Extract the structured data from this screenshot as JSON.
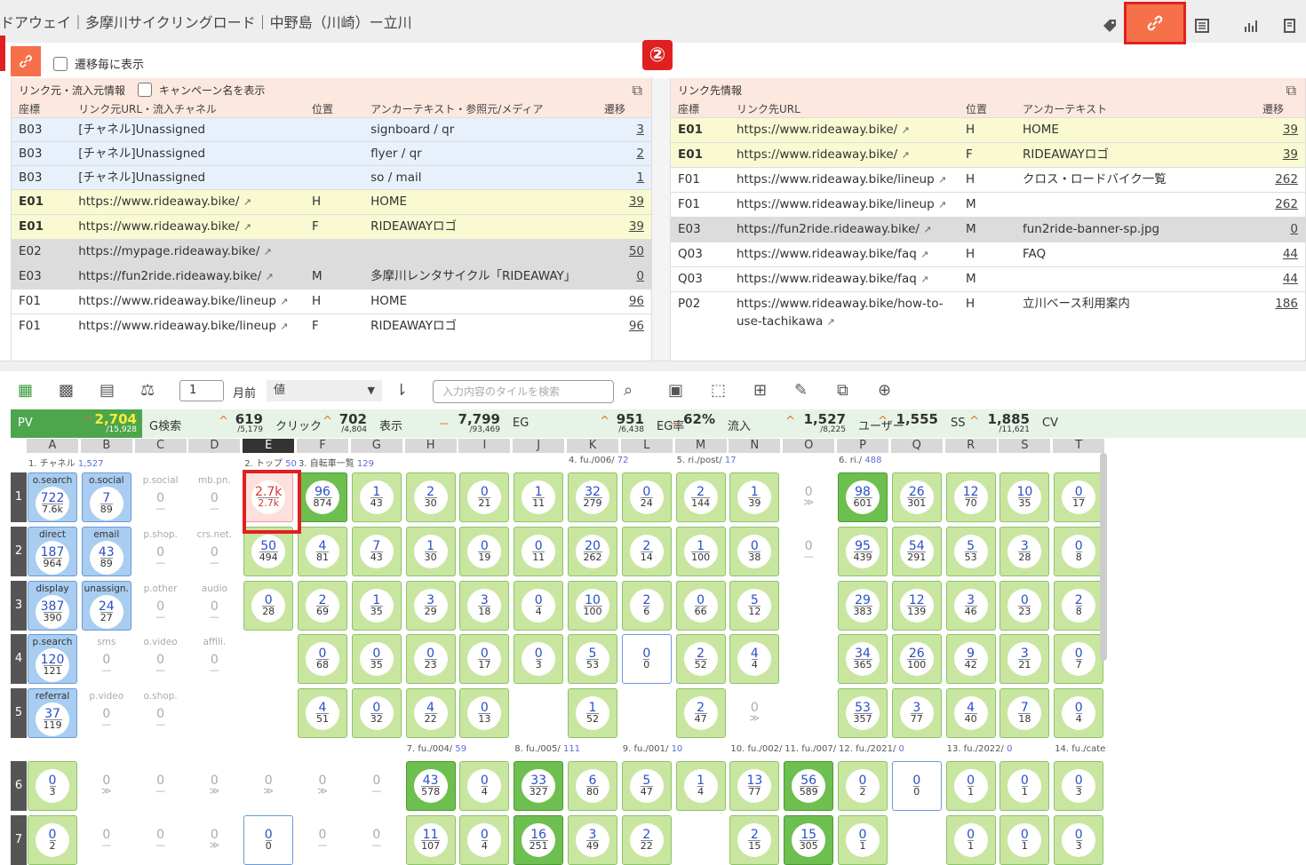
{
  "title": "ドアウェイ｜多摩川サイクリングロード｜中野島（川崎）ー立川",
  "badge": "②",
  "transition_label": "遷移毎に表示",
  "left_panel": {
    "header": "リンク元・流入元情報",
    "campaign_label": "キャンペーン名を表示",
    "cols": [
      "座標",
      "リンク元URL・流入チャネル",
      "位置",
      "アンカーテキスト・参照元/メディア",
      "遷移"
    ],
    "rows": [
      {
        "c": "B03",
        "u": "[チャネル]Unassigned",
        "p": "",
        "a": "signboard / qr",
        "n": "3",
        "k": "b"
      },
      {
        "c": "B03",
        "u": "[チャネル]Unassigned",
        "p": "",
        "a": "flyer / qr",
        "n": "2",
        "k": "b"
      },
      {
        "c": "B03",
        "u": "[チャネル]Unassigned",
        "p": "",
        "a": "so / mail",
        "n": "1",
        "k": "b"
      },
      {
        "c": "E01",
        "u": "https://www.rideaway.bike/",
        "p": "H",
        "a": "HOME",
        "n": "39",
        "k": "y"
      },
      {
        "c": "E01",
        "u": "https://www.rideaway.bike/",
        "p": "F",
        "a": "RIDEAWAYロゴ",
        "n": "39",
        "k": "y"
      },
      {
        "c": "E02",
        "u": "https://mypage.rideaway.bike/",
        "p": "",
        "a": "",
        "n": "50",
        "k": "g"
      },
      {
        "c": "E03",
        "u": "https://fun2ride.rideaway.bike/",
        "p": "M",
        "a": "多摩川レンタサイクル「RIDEAWAY」",
        "n": "0",
        "k": "g"
      },
      {
        "c": "F01",
        "u": "https://www.rideaway.bike/lineup",
        "p": "H",
        "a": "HOME",
        "n": "96",
        "k": "w"
      },
      {
        "c": "F01",
        "u": "https://www.rideaway.bike/lineup",
        "p": "F",
        "a": "RIDEAWAYロゴ",
        "n": "96",
        "k": "w"
      }
    ]
  },
  "right_panel": {
    "header": "リンク先情報",
    "cols": [
      "座標",
      "リンク先URL",
      "位置",
      "アンカーテキスト",
      "遷移"
    ],
    "rows": [
      {
        "c": "E01",
        "u": "https://www.rideaway.bike/",
        "p": "H",
        "a": "HOME",
        "n": "39",
        "k": "y"
      },
      {
        "c": "E01",
        "u": "https://www.rideaway.bike/",
        "p": "F",
        "a": "RIDEAWAYロゴ",
        "n": "39",
        "k": "y"
      },
      {
        "c": "F01",
        "u": "https://www.rideaway.bike/lineup",
        "p": "H",
        "a": "クロス・ロードバイク一覧",
        "n": "262",
        "k": "w"
      },
      {
        "c": "F01",
        "u": "https://www.rideaway.bike/lineup",
        "p": "M",
        "a": "",
        "n": "262",
        "k": "w"
      },
      {
        "c": "E03",
        "u": "https://fun2ride.rideaway.bike/",
        "p": "M",
        "a": "fun2ride-banner-sp.jpg",
        "n": "0",
        "k": "g"
      },
      {
        "c": "Q03",
        "u": "https://www.rideaway.bike/faq",
        "p": "H",
        "a": "FAQ",
        "n": "44",
        "k": "w"
      },
      {
        "c": "Q03",
        "u": "https://www.rideaway.bike/faq",
        "p": "M",
        "a": "",
        "n": "44",
        "k": "w"
      },
      {
        "c": "P02",
        "u": "https://www.rideaway.bike/how-to-use-tachikawa",
        "p": "H",
        "a": "立川ベース利用案内",
        "n": "186",
        "k": "w"
      }
    ]
  },
  "toolbar": {
    "months": "1",
    "month_unit": "月前",
    "value_select": "値",
    "search_placeholder": "入力内容のタイルを検索"
  },
  "metrics": [
    {
      "label": "PV",
      "trend": "^",
      "val": "2,704",
      "sub": "/15,928"
    },
    {
      "label": "G検索",
      "trend": "^",
      "val": "619",
      "sub": "/5,179"
    },
    {
      "label": "クリック",
      "trend": "^",
      "val": "702",
      "sub": "/4,804"
    },
    {
      "label": "表示",
      "trend": "－",
      "val": "7,799",
      "sub": "/93,469"
    },
    {
      "label": "EG",
      "trend": "^",
      "val": "951",
      "sub": "/6,438"
    },
    {
      "label": "EG率",
      "trend": "－",
      "val": "62%",
      "sub": ""
    },
    {
      "label": "流入",
      "trend": "^",
      "val": "1,527",
      "sub": "/8,225"
    },
    {
      "label": "ユーザー",
      "trend": "^",
      "val": "1,555",
      "sub": ""
    },
    {
      "label": "SS",
      "trend": "^",
      "val": "1,885",
      "sub": "/11,621"
    },
    {
      "label": "CV",
      "trend": "",
      "val": "",
      "sub": ""
    }
  ],
  "columns": [
    "A",
    "B",
    "C",
    "D",
    "E",
    "F",
    "G",
    "H",
    "I",
    "J",
    "K",
    "L",
    "M",
    "N",
    "O",
    "P",
    "Q",
    "R",
    "S",
    "T"
  ],
  "page_labels_top": [
    {
      "col": 0,
      "t": "1. チャネル",
      "n": "1,527"
    },
    {
      "col": 4,
      "t": "2. トップ",
      "n": "50"
    },
    {
      "col": 5,
      "t": "3. 自転車一覧",
      "n": "129"
    },
    {
      "col": 10,
      "t": "4. fu./006/",
      "n": "72"
    },
    {
      "col": 12,
      "t": "5. ri./post/",
      "n": "17"
    },
    {
      "col": 15,
      "t": "6. ri./",
      "n": "488"
    }
  ],
  "page_labels_mid": [
    {
      "col": 7,
      "t": "7. fu./004/",
      "n": "59"
    },
    {
      "col": 9,
      "t": "8. fu./005/",
      "n": "111"
    },
    {
      "col": 11,
      "t": "9. fu./001/",
      "n": "10"
    },
    {
      "col": 13,
      "t": "10. fu./002/",
      "n": ""
    },
    {
      "col": 14,
      "t": "11. fu./007/",
      "n": ""
    },
    {
      "col": 15,
      "t": "12. fu./2021/",
      "n": "0"
    },
    {
      "col": 17,
      "t": "13. fu./2022/",
      "n": "0"
    },
    {
      "col": 19,
      "t": "14. fu./cate",
      "n": ""
    }
  ],
  "rows": [
    "1",
    "2",
    "3",
    "4",
    "5",
    "6",
    "7"
  ],
  "grid": [
    [
      {
        "s": "cb2",
        "t": "o.search",
        "a": "722",
        "b": "7.6k"
      },
      {
        "s": "cb2",
        "t": "o.social",
        "a": "7",
        "b": "89"
      },
      {
        "s": "cempty",
        "t": "p.social",
        "a": "0",
        "b": "—"
      },
      {
        "s": "cempty",
        "t": "mb.pn.",
        "a": "0",
        "b": "—"
      },
      {
        "s": "sel",
        "t": "",
        "a": "2.7k",
        "b": "2.7k"
      },
      {
        "s": "cgd",
        "t": "",
        "a": "96",
        "b": "874"
      },
      {
        "s": "cg",
        "t": "",
        "a": "1",
        "b": "43"
      },
      {
        "s": "cg",
        "t": "",
        "a": "2",
        "b": "30"
      },
      {
        "s": "cg",
        "t": "",
        "a": "0",
        "b": "21"
      },
      {
        "s": "cg",
        "t": "",
        "a": "1",
        "b": "11"
      },
      {
        "s": "cg",
        "t": "",
        "a": "32",
        "b": "279"
      },
      {
        "s": "cg",
        "t": "",
        "a": "0",
        "b": "24"
      },
      {
        "s": "cg",
        "t": "",
        "a": "2",
        "b": "144"
      },
      {
        "s": "cg",
        "t": "",
        "a": "1",
        "b": "39"
      },
      {
        "s": "cempty",
        "t": "",
        "a": "0",
        "b": "≫"
      },
      {
        "s": "cgd",
        "t": "",
        "a": "98",
        "b": "601"
      },
      {
        "s": "cg",
        "t": "",
        "a": "26",
        "b": "301"
      },
      {
        "s": "cg",
        "t": "",
        "a": "12",
        "b": "70"
      },
      {
        "s": "cg",
        "t": "",
        "a": "10",
        "b": "35"
      },
      {
        "s": "cg",
        "t": "",
        "a": "0",
        "b": "17"
      }
    ],
    [
      {
        "s": "cb2",
        "t": "direct",
        "a": "187",
        "b": "964"
      },
      {
        "s": "cb2",
        "t": "email",
        "a": "43",
        "b": "89"
      },
      {
        "s": "cempty",
        "t": "p.shop.",
        "a": "0",
        "b": "—"
      },
      {
        "s": "cempty",
        "t": "crs.net.",
        "a": "0",
        "b": "—"
      },
      {
        "s": "cg",
        "t": "",
        "a": "50",
        "b": "494"
      },
      {
        "s": "cg",
        "t": "",
        "a": "4",
        "b": "81"
      },
      {
        "s": "cg",
        "t": "",
        "a": "7",
        "b": "43"
      },
      {
        "s": "cg",
        "t": "",
        "a": "1",
        "b": "30"
      },
      {
        "s": "cg",
        "t": "",
        "a": "0",
        "b": "19"
      },
      {
        "s": "cg",
        "t": "",
        "a": "0",
        "b": "11"
      },
      {
        "s": "cg",
        "t": "",
        "a": "20",
        "b": "262"
      },
      {
        "s": "cg",
        "t": "",
        "a": "2",
        "b": "14"
      },
      {
        "s": "cg",
        "t": "",
        "a": "1",
        "b": "100"
      },
      {
        "s": "cg",
        "t": "",
        "a": "0",
        "b": "38"
      },
      {
        "s": "cempty",
        "t": "",
        "a": "0",
        "b": "—"
      },
      {
        "s": "cg",
        "t": "",
        "a": "95",
        "b": "439"
      },
      {
        "s": "cg",
        "t": "",
        "a": "54",
        "b": "291"
      },
      {
        "s": "cg",
        "t": "",
        "a": "5",
        "b": "53"
      },
      {
        "s": "cg",
        "t": "",
        "a": "3",
        "b": "28"
      },
      {
        "s": "cg",
        "t": "",
        "a": "0",
        "b": "8"
      }
    ],
    [
      {
        "s": "cb2",
        "t": "display",
        "a": "387",
        "b": "390"
      },
      {
        "s": "cb2",
        "t": "unassign.",
        "a": "24",
        "b": "27"
      },
      {
        "s": "cempty",
        "t": "p.other",
        "a": "0",
        "b": "—"
      },
      {
        "s": "cempty",
        "t": "audio",
        "a": "0",
        "b": "—"
      },
      {
        "s": "cg",
        "t": "",
        "a": "0",
        "b": "28"
      },
      {
        "s": "cg",
        "t": "",
        "a": "2",
        "b": "69"
      },
      {
        "s": "cg",
        "t": "",
        "a": "1",
        "b": "35"
      },
      {
        "s": "cg",
        "t": "",
        "a": "3",
        "b": "29"
      },
      {
        "s": "cg",
        "t": "",
        "a": "3",
        "b": "18"
      },
      {
        "s": "cg",
        "t": "",
        "a": "0",
        "b": "4"
      },
      {
        "s": "cg",
        "t": "",
        "a": "10",
        "b": "100"
      },
      {
        "s": "cg",
        "t": "",
        "a": "2",
        "b": "6"
      },
      {
        "s": "cg",
        "t": "",
        "a": "0",
        "b": "66"
      },
      {
        "s": "cg",
        "t": "",
        "a": "5",
        "b": "12"
      },
      null,
      {
        "s": "cg",
        "t": "",
        "a": "29",
        "b": "383"
      },
      {
        "s": "cg",
        "t": "",
        "a": "12",
        "b": "139"
      },
      {
        "s": "cg",
        "t": "",
        "a": "3",
        "b": "46"
      },
      {
        "s": "cg",
        "t": "",
        "a": "0",
        "b": "23"
      },
      {
        "s": "cg",
        "t": "",
        "a": "2",
        "b": "8"
      }
    ],
    [
      {
        "s": "cb2",
        "t": "p.search",
        "a": "120",
        "b": "121"
      },
      {
        "s": "cempty",
        "t": "sms",
        "a": "0",
        "b": "—"
      },
      {
        "s": "cempty",
        "t": "o.video",
        "a": "0",
        "b": "—"
      },
      {
        "s": "cempty",
        "t": "affili.",
        "a": "0",
        "b": "—"
      },
      null,
      {
        "s": "cg",
        "t": "",
        "a": "0",
        "b": "68"
      },
      {
        "s": "cg",
        "t": "",
        "a": "0",
        "b": "35"
      },
      {
        "s": "cg",
        "t": "",
        "a": "0",
        "b": "23"
      },
      {
        "s": "cg",
        "t": "",
        "a": "0",
        "b": "17"
      },
      {
        "s": "cg",
        "t": "",
        "a": "0",
        "b": "3"
      },
      {
        "s": "cg",
        "t": "",
        "a": "5",
        "b": "53"
      },
      {
        "s": "cbl",
        "t": "",
        "a": "0",
        "b": "0"
      },
      {
        "s": "cg",
        "t": "",
        "a": "2",
        "b": "52"
      },
      {
        "s": "cg",
        "t": "",
        "a": "4",
        "b": "4"
      },
      null,
      {
        "s": "cg",
        "t": "",
        "a": "34",
        "b": "365"
      },
      {
        "s": "cg",
        "t": "",
        "a": "26",
        "b": "100"
      },
      {
        "s": "cg",
        "t": "",
        "a": "9",
        "b": "42"
      },
      {
        "s": "cg",
        "t": "",
        "a": "3",
        "b": "21"
      },
      {
        "s": "cg",
        "t": "",
        "a": "0",
        "b": "7"
      }
    ],
    [
      {
        "s": "cb2",
        "t": "referral",
        "a": "37",
        "b": "119"
      },
      {
        "s": "cempty",
        "t": "p.video",
        "a": "0",
        "b": "—"
      },
      {
        "s": "cempty",
        "t": "o.shop.",
        "a": "0",
        "b": "—"
      },
      null,
      null,
      {
        "s": "cg",
        "t": "",
        "a": "4",
        "b": "51"
      },
      {
        "s": "cg",
        "t": "",
        "a": "0",
        "b": "32"
      },
      {
        "s": "cg",
        "t": "",
        "a": "4",
        "b": "22"
      },
      {
        "s": "cg",
        "t": "",
        "a": "0",
        "b": "13"
      },
      null,
      {
        "s": "cg",
        "t": "",
        "a": "1",
        "b": "52"
      },
      null,
      {
        "s": "cg",
        "t": "",
        "a": "2",
        "b": "47"
      },
      {
        "s": "cempty",
        "t": "",
        "a": "0",
        "b": "≫"
      },
      null,
      {
        "s": "cg",
        "t": "",
        "a": "53",
        "b": "357"
      },
      {
        "s": "cg",
        "t": "",
        "a": "3",
        "b": "77"
      },
      {
        "s": "cg",
        "t": "",
        "a": "4",
        "b": "40"
      },
      {
        "s": "cg",
        "t": "",
        "a": "7",
        "b": "18"
      },
      {
        "s": "cg",
        "t": "",
        "a": "0",
        "b": "4"
      }
    ],
    [
      {
        "s": "cg",
        "t": "",
        "a": "0",
        "b": "3"
      },
      {
        "s": "cempty",
        "t": "",
        "a": "0",
        "b": "≫"
      },
      {
        "s": "cempty",
        "t": "",
        "a": "0",
        "b": "—"
      },
      {
        "s": "cempty",
        "t": "",
        "a": "0",
        "b": "≫"
      },
      {
        "s": "cempty",
        "t": "",
        "a": "0",
        "b": "≫"
      },
      {
        "s": "cempty",
        "t": "",
        "a": "0",
        "b": "≫"
      },
      {
        "s": "cempty",
        "t": "",
        "a": "0",
        "b": "—"
      },
      {
        "s": "cgd",
        "t": "",
        "a": "43",
        "b": "578"
      },
      {
        "s": "cg",
        "t": "",
        "a": "0",
        "b": "4"
      },
      {
        "s": "cgd",
        "t": "",
        "a": "33",
        "b": "327"
      },
      {
        "s": "cg",
        "t": "",
        "a": "6",
        "b": "80"
      },
      {
        "s": "cg",
        "t": "",
        "a": "5",
        "b": "47"
      },
      {
        "s": "cg",
        "t": "",
        "a": "1",
        "b": "4"
      },
      {
        "s": "cg",
        "t": "",
        "a": "13",
        "b": "77"
      },
      {
        "s": "cgd",
        "t": "",
        "a": "56",
        "b": "589"
      },
      {
        "s": "cg",
        "t": "",
        "a": "0",
        "b": "2"
      },
      {
        "s": "cbl",
        "t": "",
        "a": "0",
        "b": "0"
      },
      {
        "s": "cg",
        "t": "",
        "a": "0",
        "b": "1"
      },
      {
        "s": "cg",
        "t": "",
        "a": "0",
        "b": "1"
      },
      {
        "s": "cg",
        "t": "",
        "a": "0",
        "b": "3"
      }
    ],
    [
      {
        "s": "cg",
        "t": "",
        "a": "0",
        "b": "2"
      },
      {
        "s": "cempty",
        "t": "",
        "a": "0",
        "b": "—"
      },
      {
        "s": "cempty",
        "t": "",
        "a": "0",
        "b": "—"
      },
      {
        "s": "cempty",
        "t": "",
        "a": "0",
        "b": "≫"
      },
      {
        "s": "cbl",
        "t": "",
        "a": "0",
        "b": "0"
      },
      {
        "s": "cempty",
        "t": "",
        "a": "0",
        "b": "—"
      },
      {
        "s": "cempty",
        "t": "",
        "a": "0",
        "b": "—"
      },
      {
        "s": "cg",
        "t": "",
        "a": "11",
        "b": "107"
      },
      {
        "s": "cg",
        "t": "",
        "a": "0",
        "b": "4"
      },
      {
        "s": "cgd",
        "t": "",
        "a": "16",
        "b": "251"
      },
      {
        "s": "cg",
        "t": "",
        "a": "3",
        "b": "49"
      },
      {
        "s": "cg",
        "t": "",
        "a": "2",
        "b": "22"
      },
      null,
      {
        "s": "cg",
        "t": "",
        "a": "2",
        "b": "15"
      },
      {
        "s": "cgd",
        "t": "",
        "a": "15",
        "b": "305"
      },
      {
        "s": "cg",
        "t": "",
        "a": "0",
        "b": "1"
      },
      null,
      {
        "s": "cg",
        "t": "",
        "a": "0",
        "b": "1"
      },
      {
        "s": "cg",
        "t": "",
        "a": "0",
        "b": "1"
      },
      {
        "s": "cg",
        "t": "",
        "a": "0",
        "b": "3"
      }
    ]
  ]
}
